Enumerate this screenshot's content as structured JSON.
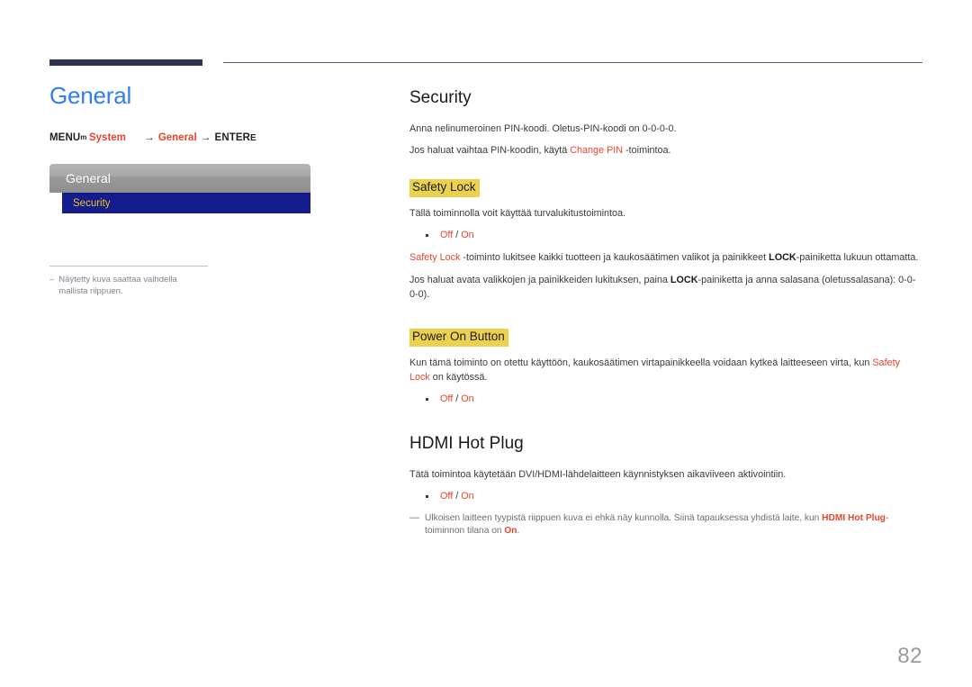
{
  "page": {
    "number": "82",
    "title": "General"
  },
  "menu_path": {
    "menu_label": "MENU",
    "menu_glyph": "m",
    "item1": "System",
    "arrow": "→",
    "item2": "General",
    "enter_label": "ENTER",
    "enter_glyph": "E"
  },
  "osd": {
    "header": "General",
    "selected_row": "Security"
  },
  "left_note": {
    "dash": "–",
    "text": "Näytetty kuva saattaa vaihdella mallista riippuen."
  },
  "sections": {
    "security": {
      "title": "Security",
      "line1": "Anna nelinumeroinen PIN-koodi. Oletus-PIN-koodi on 0-0-0-0.",
      "line2_pre": "Jos haluat vaihtaa PIN-koodin, käytä ",
      "line2_link": "Change PIN",
      "line2_post": " -toimintoa."
    },
    "safety_lock": {
      "heading": "Safety Lock",
      "intro": "Tällä toiminnolla voit käyttää turvalukitustoimintoa.",
      "option_off": "Off",
      "option_slash": " / ",
      "option_on": "On",
      "para1_term": "Safety Lock",
      "para1_mid": " -toiminto lukitsee kaikki tuotteen ja kaukosäätimen valikot ja painikkeet ",
      "para1_bold": "LOCK",
      "para1_end": "-painiketta lukuun ottamatta.",
      "para2_pre": "Jos haluat avata valikkojen ja painikkeiden lukituksen, paina ",
      "para2_bold": "LOCK",
      "para2_post": "-painiketta ja anna salasana (oletussalasana): 0-0-0-0)."
    },
    "power_on_button": {
      "heading": "Power On Button",
      "para_pre": "Kun tämä toiminto on otettu käyttöön, kaukosäätimen virtapainikkeella voidaan kytkeä laitteeseen virta, kun ",
      "para_term": "Safety Lock",
      "para_post": " on käytössä.",
      "option_off": "Off",
      "option_slash": " / ",
      "option_on": "On"
    },
    "hdmi_hot_plug": {
      "title": "HDMI Hot Plug",
      "intro": "Tätä toimintoa käytetään DVI/HDMI-lähdelaitteen käynnistyksen aikaviiveen aktivointiin.",
      "option_off": "Off",
      "option_slash": " / ",
      "option_on": "On",
      "tip_dash": "—",
      "tip_pre": "Ulkoisen laitteen tyypistä riippuen kuva ei ehkä näy kunnolla. Siinä tapauksessa yhdistä laite, kun ",
      "tip_term": "HDMI Hot Plug",
      "tip_mid": "-toiminnon tilana on ",
      "tip_state": "On",
      "tip_end": "."
    }
  },
  "colors": {
    "title_blue": "#2e7df6",
    "accent_orange": "#e8452c",
    "highlight_yellow": "#ecd24c",
    "osd_navy": "#151d8e",
    "osd_gold": "#f0c419",
    "rule_navy": "#2e3352"
  }
}
